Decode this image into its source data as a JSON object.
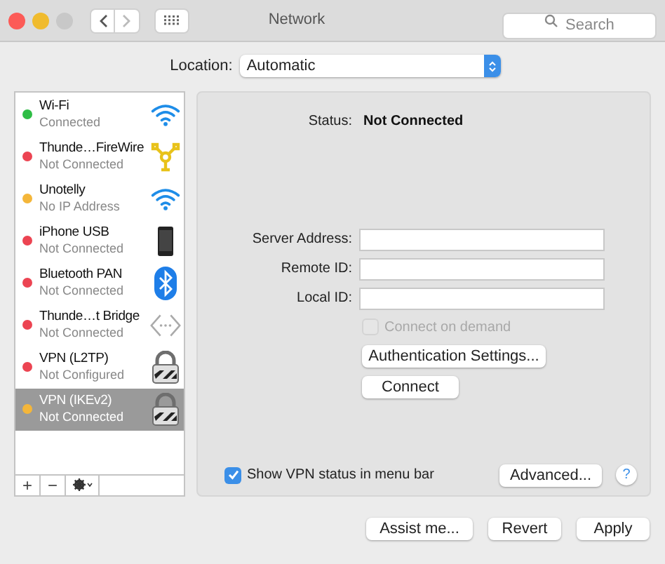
{
  "window": {
    "title": "Network",
    "search": {
      "placeholder": "Search"
    }
  },
  "toolbar": {
    "back_disabled": false,
    "forward_disabled": true
  },
  "location": {
    "label": "Location:",
    "value": "Automatic"
  },
  "services": [
    {
      "name": "Wi-Fi",
      "status": "Connected",
      "color": "#2ebd45",
      "kind": "wifi",
      "selected": false
    },
    {
      "name": "Thunde…FireWire",
      "status": "Not Connected",
      "color": "#ec4452",
      "kind": "firewire",
      "selected": false
    },
    {
      "name": "Unotelly",
      "status": "No IP Address",
      "color": "#f4b63a",
      "kind": "wifi",
      "selected": false
    },
    {
      "name": "iPhone USB",
      "status": "Not Connected",
      "color": "#ec4452",
      "kind": "phone",
      "selected": false
    },
    {
      "name": "Bluetooth PAN",
      "status": "Not Connected",
      "color": "#ec4452",
      "kind": "bluetooth",
      "selected": false
    },
    {
      "name": "Thunde…t Bridge",
      "status": "Not Connected",
      "color": "#ec4452",
      "kind": "bridge",
      "selected": false
    },
    {
      "name": "VPN (L2TP)",
      "status": "Not Configured",
      "color": "#ec4452",
      "kind": "lock",
      "selected": false
    },
    {
      "name": "VPN (IKEv2)",
      "status": "Not Connected",
      "color": "#f4b63a",
      "kind": "lock",
      "selected": true
    }
  ],
  "list_buttons": {
    "add": "+",
    "remove": "−"
  },
  "status": {
    "label": "Status:",
    "value": "Not Connected"
  },
  "fields": [
    {
      "label": "Server Address:"
    },
    {
      "label": "Remote ID:"
    },
    {
      "label": "Local ID:"
    }
  ],
  "connect_on_demand": {
    "label": "Connect on demand",
    "checked": false,
    "disabled": true
  },
  "auth_button": "Authentication Settings...",
  "connect_button": "Connect",
  "show_vpn_status": {
    "label": "Show VPN status in menu bar",
    "checked": true
  },
  "advanced_button": "Advanced...",
  "help": "?",
  "buttons": [
    "Assist me...",
    "Revert",
    "Apply"
  ]
}
